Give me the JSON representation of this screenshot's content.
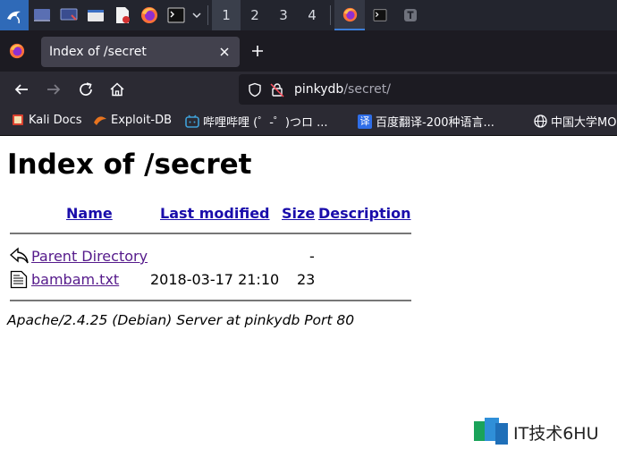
{
  "taskbar": {
    "workspaces": [
      "1",
      "2",
      "3",
      "4"
    ]
  },
  "browser": {
    "tab_title": "Index of /secret",
    "url_host": "pinkydb",
    "url_path": "/secret/",
    "bookmarks": [
      {
        "label": "Kali Docs"
      },
      {
        "label": "Exploit-DB"
      },
      {
        "label": "哔哩哔哩 (゜-゜)つロ ..."
      },
      {
        "label": "百度翻译-200种语言..."
      },
      {
        "label": "中国大学MO"
      }
    ]
  },
  "page": {
    "title": "Index of /secret",
    "columns": [
      "Name",
      "Last modified",
      "Size",
      "Description"
    ],
    "rows": [
      {
        "name": "Parent Directory",
        "modified": "",
        "size": "-",
        "description": ""
      },
      {
        "name": "bambam.txt",
        "modified": "2018-03-17 21:10",
        "size": "23",
        "description": ""
      }
    ],
    "address": "Apache/2.4.25 (Debian) Server at pinkydb Port 80"
  },
  "watermark": {
    "text": "IT技术6HU"
  },
  "colors": {
    "taskbar_bg": "#23252e",
    "tab_bg": "#42414d",
    "toolbar_bg": "#2b2a33",
    "link_visited": "#551a8b",
    "header_link": "#1a0dab"
  }
}
